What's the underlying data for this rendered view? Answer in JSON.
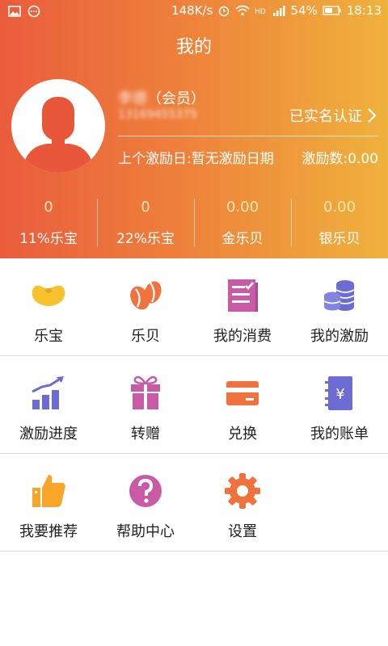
{
  "status_bar": {
    "net_speed": "148K/s",
    "battery": "54%",
    "time": "18:13",
    "icons": [
      "image-icon",
      "chat-icon",
      "alarm-icon",
      "wifi-icon",
      "hd-icon",
      "signal-icon",
      "battery-icon"
    ]
  },
  "page_title": "我的",
  "profile": {
    "name": "李德",
    "member_tag": "（会员）",
    "phone": "13169455375",
    "verify_text": "已实名认证",
    "last_incentive": "上个激励日:暂无激励日期",
    "incentive_count": "激励数:0.00"
  },
  "stats": [
    {
      "value": "0",
      "label": "11%乐宝"
    },
    {
      "value": "0",
      "label": "22%乐宝"
    },
    {
      "value": "0.00",
      "label": "金乐贝"
    },
    {
      "value": "0.00",
      "label": "银乐贝"
    }
  ],
  "menu_rows": [
    [
      {
        "label": "乐宝",
        "icon": "bean-icon"
      },
      {
        "label": "乐贝",
        "icon": "coffee-beans-icon"
      },
      {
        "label": "我的消费",
        "icon": "receipt-icon"
      },
      {
        "label": "我的激励",
        "icon": "coins-icon"
      }
    ],
    [
      {
        "label": "激励进度",
        "icon": "growth-chart-icon"
      },
      {
        "label": "转赠",
        "icon": "gift-icon"
      },
      {
        "label": "兑换",
        "icon": "card-icon"
      },
      {
        "label": "我的账单",
        "icon": "bill-icon"
      }
    ],
    [
      {
        "label": "我要推荐",
        "icon": "thumbs-up-icon"
      },
      {
        "label": "帮助中心",
        "icon": "help-icon"
      },
      {
        "label": "设置",
        "icon": "gear-icon"
      }
    ]
  ],
  "colors": {
    "header_start": "#ea5c3c",
    "header_end": "#efb23c",
    "stat_value": "#fde9b3"
  }
}
